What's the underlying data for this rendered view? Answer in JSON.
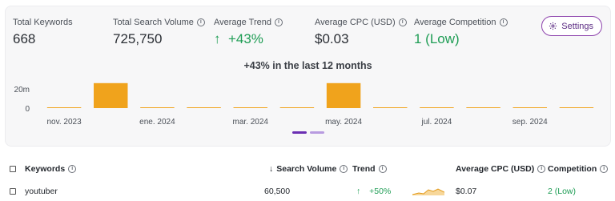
{
  "metrics": {
    "total_keywords": {
      "label": "Total Keywords",
      "value": "668"
    },
    "total_search_volume": {
      "label": "Total Search Volume",
      "value": "725,750"
    },
    "average_trend": {
      "label": "Average Trend",
      "arrow": "↑",
      "value": "+43%"
    },
    "average_cpc": {
      "label": "Average CPC (USD)",
      "value": "$0.03"
    },
    "average_competition": {
      "label": "Average Competition",
      "value": "1 (Low)"
    }
  },
  "settings_label": "Settings",
  "chart_data": {
    "type": "bar",
    "title": "+43% in the last 12 months",
    "y_tick_labels": [
      "20m",
      "0"
    ],
    "x_tick_labels": [
      "nov. 2023",
      "ene. 2024",
      "mar. 2024",
      "may. 2024",
      "jul. 2024",
      "sep. 2024"
    ],
    "categories": [
      "nov. 2023",
      "dic. 2023",
      "ene. 2024",
      "feb. 2024",
      "mar. 2024",
      "abr. 2024",
      "may. 2024",
      "jun. 2024",
      "jul. 2024",
      "ago. 2024",
      "sep. 2024",
      "oct. 2024"
    ],
    "values": [
      0.3,
      26,
      0.3,
      0.4,
      0.3,
      0.2,
      26,
      0.3,
      0.3,
      0.3,
      0.4,
      0.5
    ],
    "unit": "millions",
    "ylim": [
      0,
      30
    ],
    "bar_color": "#f0a31c"
  },
  "pager": {
    "active_color": "#6b2fb3",
    "inactive_color": "#b89be0"
  },
  "table": {
    "headers": {
      "keywords": "Keywords",
      "search_volume_arrow": "↓",
      "search_volume": "Search Volume",
      "trend": "Trend",
      "avg_cpc": "Average CPC (USD)",
      "competition": "Competition"
    },
    "rows": [
      {
        "keyword": "youtuber",
        "search_volume": "60,500",
        "trend_arrow": "↑",
        "trend": "+50%",
        "cpc": "$0.07",
        "competition": "2 (Low)"
      }
    ]
  }
}
